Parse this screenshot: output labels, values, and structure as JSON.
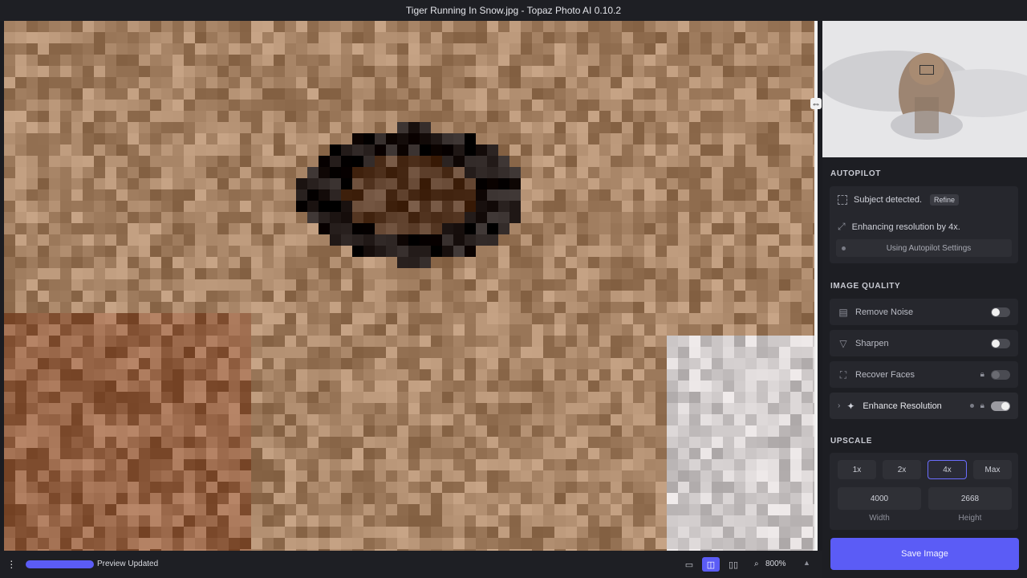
{
  "window": {
    "title": "Tiger Running In Snow.jpg - Topaz Photo AI 0.10.2"
  },
  "autopilot": {
    "title": "AUTOPILOT",
    "subject_text": "Subject",
    "detected_text": "detected.",
    "refine_label": "Refine",
    "enhance_text": "Enhancing resolution by 4x.",
    "settings_label": "Using Autopilot Settings"
  },
  "image_quality": {
    "title": "IMAGE QUALITY",
    "items": [
      {
        "label": "Remove Noise",
        "icon": "noise-icon",
        "enabled": false
      },
      {
        "label": "Sharpen",
        "icon": "sharpen-icon",
        "enabled": false
      },
      {
        "label": "Recover Faces",
        "icon": "face-icon",
        "enabled": false,
        "locked": true
      },
      {
        "label": "Enhance Resolution",
        "icon": "sparkle-icon",
        "enabled": true,
        "locked": true
      }
    ]
  },
  "upscale": {
    "title": "UPSCALE",
    "options": [
      "1x",
      "2x",
      "4x",
      "Max"
    ],
    "selected": "4x",
    "width_value": "4000",
    "height_value": "2668",
    "width_label": "Width",
    "height_label": "Height"
  },
  "save_label": "Save Image",
  "status": {
    "text": "Preview Updated",
    "progress": 1.0
  },
  "zoom": {
    "value": "800%"
  },
  "colors": {
    "accent": "#5b5cf6",
    "panel": "#1d1e23"
  }
}
